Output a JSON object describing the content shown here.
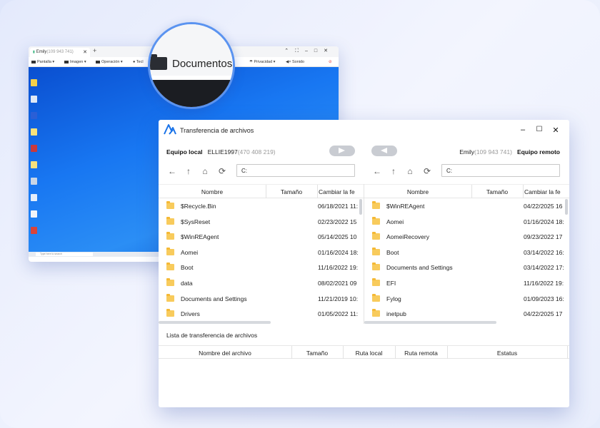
{
  "remote_window": {
    "tab_label": "Emily",
    "tab_id": "(109 943 741)",
    "toolbar": [
      "Pantalla",
      "Imagen",
      "Operación",
      "Tecl",
      "Privacidad",
      "Sonido"
    ],
    "taskbar_search_placeholder": "Type here to search"
  },
  "magnifier": {
    "label": "Documentos"
  },
  "file_transfer": {
    "title": "Transferencia de archivos",
    "local": {
      "label": "Equipo local",
      "device": "ELLIE1997",
      "id": "(470 408 219)",
      "path": "C:",
      "columns": [
        "Nombre",
        "Tamaño",
        "Cambiar la fe"
      ],
      "files": [
        {
          "name": "$Recycle.Bin",
          "modified": "06/18/2021 11:4"
        },
        {
          "name": "$SysReset",
          "modified": "02/23/2022 15"
        },
        {
          "name": "$WinREAgent",
          "modified": "05/14/2025 10"
        },
        {
          "name": "Aomei",
          "modified": "01/16/2024 18:"
        },
        {
          "name": "Boot",
          "modified": "11/16/2022 19:0"
        },
        {
          "name": "data",
          "modified": "08/02/2021 09"
        },
        {
          "name": "Documents and Settings",
          "modified": "11/21/2019 10:5"
        },
        {
          "name": "Drivers",
          "modified": "01/05/2022 11:"
        }
      ]
    },
    "remote": {
      "label": "Equipo remoto",
      "device": "Emily",
      "id": "(109 943 741)",
      "path": "C:",
      "columns": [
        "Nombre",
        "Tamaño",
        "Cambiar la fe"
      ],
      "files": [
        {
          "name": "$WinREAgent",
          "modified": "04/22/2025 16"
        },
        {
          "name": "Aomei",
          "modified": "01/16/2024 18:"
        },
        {
          "name": "AomeiRecovery",
          "modified": "09/23/2022 17"
        },
        {
          "name": "Boot",
          "modified": "03/14/2022 16:"
        },
        {
          "name": "Documents and Settings",
          "modified": "03/14/2022 17:"
        },
        {
          "name": "EFI",
          "modified": "11/16/2022 19:2"
        },
        {
          "name": "Fylog",
          "modified": "01/09/2023 16:"
        },
        {
          "name": "inetpub",
          "modified": "04/22/2025 17"
        }
      ]
    },
    "transfer_list": {
      "title": "Lista de transferencia de archivos",
      "columns": [
        "Nombre del archivo",
        "Tamaño",
        "Ruta local",
        "Ruta remota",
        "Estatus"
      ]
    }
  },
  "colors": {
    "accent": "#1a73e8",
    "folder": "#f8cb5c",
    "desktop": "#1877f2"
  }
}
